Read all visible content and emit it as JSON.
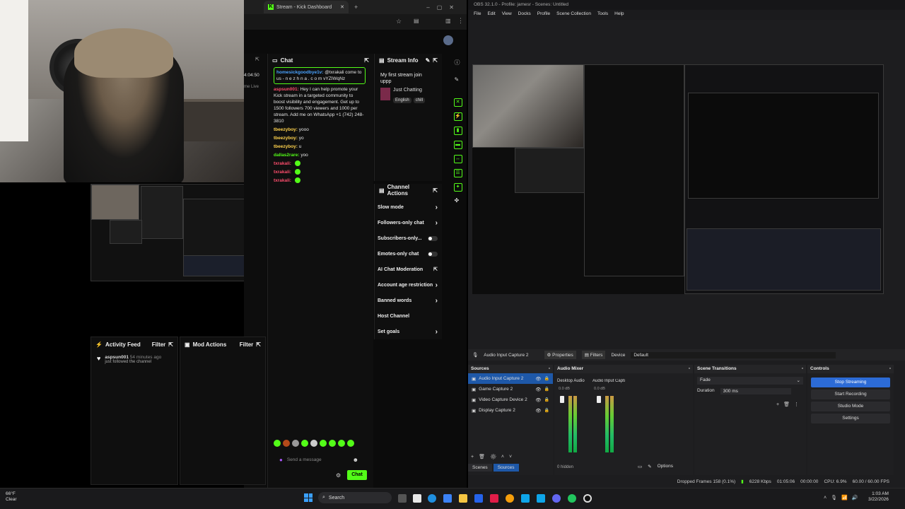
{
  "browser": {
    "tab_title": "Stream - Kick Dashboard",
    "partial_time": "4:04:50",
    "partial_live": "me Live"
  },
  "chat": {
    "title": "Chat",
    "messages": [
      {
        "user": "homesickgoodbye1v:",
        "text": "@txrakali come to us - n e z h n a . c o m vYZIWqNz",
        "color": "#4aa3ff",
        "pinned": true
      },
      {
        "user": "aspsun001:",
        "text": "Hey I can help promote your Kick stream in a targeted community to boost visibility and engagement. Get up to 1500 followers 700 viewers and 1000 per stream. Add me on WhatsApp +1 (742) 248-3810",
        "color": "#ff4d6d"
      },
      {
        "user": "tbeezyboy:",
        "text": "yooo",
        "color": "#ffd34d"
      },
      {
        "user": "tbeezyboy:",
        "text": "yo",
        "color": "#ffd34d"
      },
      {
        "user": "tbeezyboy:",
        "text": "u",
        "color": "#ffd34d"
      },
      {
        "user": "dallas2rare:",
        "text": "yoo",
        "color": "#53fc18"
      },
      {
        "user": "txrakali:",
        "text": "",
        "color": "#ff4d6d"
      },
      {
        "user": "txrakali:",
        "text": "",
        "color": "#ff4d6d"
      },
      {
        "user": "txrakali:",
        "text": "",
        "color": "#ff4d6d"
      }
    ],
    "input_placeholder": "Send a message",
    "send_label": "Chat"
  },
  "stream_info": {
    "title": "Stream Info",
    "stream_title": "My first stream join uppp",
    "category": "Just Chatting",
    "tags": [
      "English",
      "chill"
    ]
  },
  "channel_actions": {
    "title": "Channel Actions",
    "items": [
      {
        "label": "Slow mode",
        "kind": "chevron"
      },
      {
        "label": "Followers-only chat",
        "kind": "chevron"
      },
      {
        "label": "Subscribers-only...",
        "kind": "toggle"
      },
      {
        "label": "Emotes-only chat",
        "kind": "toggle"
      },
      {
        "label": "AI Chat Moderation",
        "kind": "external"
      },
      {
        "label": "Account age restriction",
        "kind": "chevron"
      },
      {
        "label": "Banned words",
        "kind": "chevron"
      },
      {
        "label": "Host Channel",
        "kind": "none"
      },
      {
        "label": "Set goals",
        "kind": "chevron"
      }
    ]
  },
  "activity_feed": {
    "title": "Activity Feed",
    "filter_label": "Filter",
    "entry_user": "aspsun001",
    "entry_time": "54 minutes ago",
    "entry_text": "just followed the channel"
  },
  "mod_actions": {
    "title": "Mod Actions",
    "filter_label": "Filter"
  },
  "obs": {
    "window_title": "OBS 32.1.0 - Profile: jamesr - Scenes: Untitled",
    "menu": [
      "File",
      "Edit",
      "View",
      "Docks",
      "Profile",
      "Scene Collection",
      "Tools",
      "Help"
    ],
    "source_toolbar": {
      "selected_source": "Audio Input Capture 2",
      "properties_label": "Properties",
      "filters_label": "Filters",
      "device_label": "Device",
      "device_value": "Default"
    },
    "sources_title": "Sources",
    "sources": [
      {
        "label": "Audio Input Capture 2",
        "selected": true
      },
      {
        "label": "Game Capture 2",
        "selected": false
      },
      {
        "label": "Video Capture Device 2",
        "selected": false
      },
      {
        "label": "Display Capture 2",
        "selected": false
      }
    ],
    "tabs": [
      "Scenes",
      "Sources"
    ],
    "mixer_title": "Audio Mixer",
    "mixer_channels": [
      "Desktop Audio",
      "Audio Input Capture 2"
    ],
    "mixer_db": [
      "0.0 dB",
      "0.0 dB"
    ],
    "hidden_count": "0 hidden",
    "options_label": "Options",
    "transitions_title": "Scene Transitions",
    "transition_value": "Fade",
    "duration_label": "Duration",
    "duration_value": "300 ms",
    "controls_title": "Controls",
    "controls": [
      {
        "label": "Stop Streaming",
        "active": true
      },
      {
        "label": "Start Recording",
        "active": false
      },
      {
        "label": "Studio Mode",
        "active": false
      },
      {
        "label": "Settings",
        "active": false
      }
    ],
    "status": {
      "dropped": "Dropped Frames 158 (0.1%)",
      "bitrate": "6228 Kbps",
      "stream_time": "01:05:06",
      "rec_time": "00:00:00",
      "cpu": "CPU: 6.9%",
      "fps": "60.00 / 60.00 FPS"
    }
  },
  "taskbar": {
    "weather_temp": "66°F",
    "weather_desc": "Clear",
    "search_label": "Search",
    "time": "1:03 AM",
    "date": "3/22/2026"
  },
  "colors": {
    "kick_green": "#53fc18",
    "obs_blue": "#2c6bd6"
  }
}
